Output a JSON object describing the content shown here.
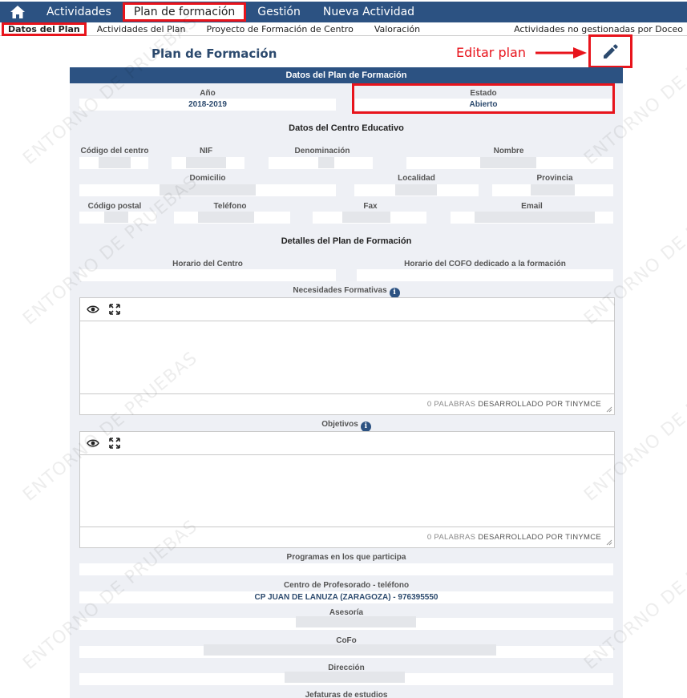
{
  "topnav": {
    "home_icon": "home-icon",
    "items": [
      "Actividades",
      "Plan de formación",
      "Gestión",
      "Nueva Actividad"
    ],
    "active_index": 1
  },
  "subnav": {
    "items": [
      "Datos del Plan",
      "Actividades del Plan",
      "Proyecto de Formación de Centro",
      "Valoración"
    ],
    "right_item": "Actividades no gestionadas por Doceo"
  },
  "page": {
    "title": "Plan de Formación",
    "edit_label": "Editar plan",
    "edit_icon": "pencil-icon"
  },
  "panel": {
    "header": "Datos del Plan de Formación",
    "anio_label": "Año",
    "anio_value": "2018-2019",
    "estado_label": "Estado",
    "estado_value": "Abierto",
    "centro_section": "Datos del Centro Educativo",
    "codigo_centro_label": "Código del centro",
    "nif_label": "NIF",
    "denominacion_label": "Denominación",
    "nombre_label": "Nombre",
    "domicilio_label": "Domicilio",
    "localidad_label": "Localidad",
    "provincia_label": "Provincia",
    "codigo_postal_label": "Código postal",
    "telefono_label": "Teléfono",
    "fax_label": "Fax",
    "email_label": "Email",
    "detalles_section": "Detalles del Plan de Formación",
    "horario_centro_label": "Horario del Centro",
    "horario_cofo_label": "Horario del COFO dedicado a la formación",
    "necesidades_label": "Necesidades Formativas",
    "objetivos_label": "Objetivos",
    "editor_words": "0 PALABRAS",
    "editor_powered": "DESARROLLADO POR TINYMCE",
    "programas_label": "Programas en los que participa",
    "cep_label": "Centro de Profesorado - teléfono",
    "cep_value": "CP JUAN DE LANUZA (ZARAGOZA) - 976395550",
    "asesoria_label": "Asesoría",
    "cofo_label": "CoFo",
    "direccion_label": "Dirección",
    "jefaturas_label": "Jefaturas de estudios"
  },
  "watermark": "ENTORNO DE PRUEBAS",
  "colors": {
    "nav_bg": "#2c5282",
    "highlight": "#e8141c",
    "panel_bg": "#eef0f5"
  }
}
